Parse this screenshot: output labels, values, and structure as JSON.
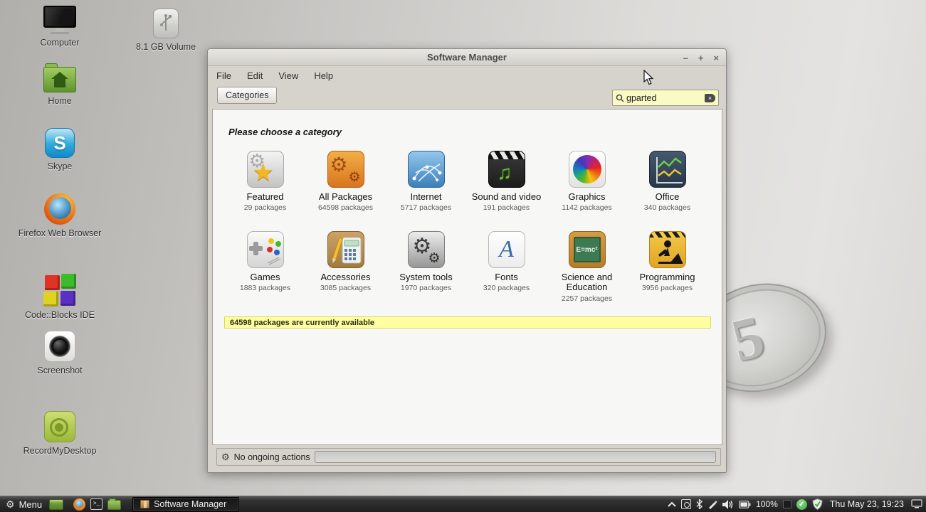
{
  "wallpaper": {
    "disc_text": "5"
  },
  "desktop": {
    "icons": [
      {
        "label": "Computer"
      },
      {
        "label": "8.1 GB Volume"
      },
      {
        "label": "Home"
      },
      {
        "label": "Skype"
      },
      {
        "label": "Firefox Web Browser"
      },
      {
        "label": "Code::Blocks IDE"
      },
      {
        "label": "Screenshot"
      },
      {
        "label": "RecordMyDesktop"
      }
    ]
  },
  "window": {
    "title": "Software Manager",
    "buttons": {
      "minimize": "–",
      "maximize": "+",
      "close": "×"
    },
    "menu": [
      "File",
      "Edit",
      "View",
      "Help"
    ],
    "toolbar": {
      "categories_label": "Categories",
      "search_value": "gparted"
    },
    "content": {
      "heading": "Please choose a category",
      "categories": [
        {
          "name": "Featured",
          "packages": "29 packages"
        },
        {
          "name": "All Packages",
          "packages": "64598 packages"
        },
        {
          "name": "Internet",
          "packages": "5717 packages"
        },
        {
          "name": "Sound and video",
          "packages": "191 packages"
        },
        {
          "name": "Graphics",
          "packages": "1142 packages"
        },
        {
          "name": "Office",
          "packages": "340 packages"
        },
        {
          "name": "Games",
          "packages": "1883 packages"
        },
        {
          "name": "Accessories",
          "packages": "3085 packages"
        },
        {
          "name": "System tools",
          "packages": "1970 packages"
        },
        {
          "name": "Fonts",
          "packages": "320 packages"
        },
        {
          "name": "Science and Education",
          "packages": "2257 packages"
        },
        {
          "name": "Programming",
          "packages": "3956 packages"
        }
      ],
      "info_bar": "64598 packages are currently available",
      "science_board_text": "E=mc²"
    },
    "statusbar": {
      "text": "No ongoing actions"
    }
  },
  "taskbar": {
    "menu_label": "Menu",
    "task_button_label": "Software Manager",
    "tray": {
      "battery": "100%",
      "clock": "Thu May 23, 19:23"
    }
  },
  "glyphs": {
    "gear": "⚙",
    "star": "★",
    "note": "♫",
    "skype_s": "S",
    "fonts_a": "A",
    "check": "✓",
    "terminal": ">_"
  }
}
